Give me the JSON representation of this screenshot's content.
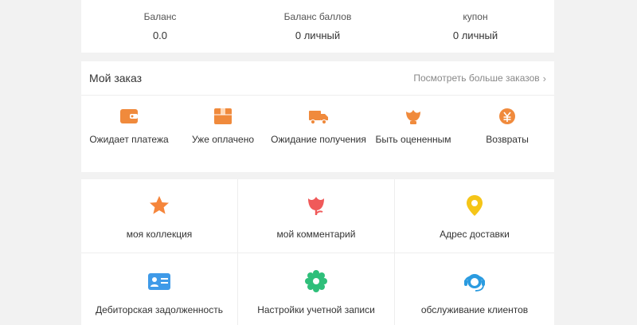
{
  "stats": [
    {
      "label": "Баланс",
      "value": "0.0"
    },
    {
      "label": "Баланс баллов",
      "value": "0 личный"
    },
    {
      "label": "купон",
      "value": "0 личный"
    }
  ],
  "orders": {
    "title": "Мой заказ",
    "more": "Посмотреть больше заказов",
    "items": [
      {
        "label": "Ожидает платежа",
        "icon": "wallet-icon",
        "color": "#f08a3c"
      },
      {
        "label": "Уже оплачено",
        "icon": "box-icon",
        "color": "#f08a3c"
      },
      {
        "label": "Ожидание получения",
        "icon": "truck-icon",
        "color": "#f08a3c"
      },
      {
        "label": "Быть оцененным",
        "icon": "lotus-icon",
        "color": "#f08a3c"
      },
      {
        "label": "Возвраты",
        "icon": "refund-icon",
        "color": "#f08a3c"
      }
    ]
  },
  "grid": [
    {
      "label": "моя коллекция",
      "icon": "star-icon",
      "color": "#f5853b"
    },
    {
      "label": "мой комментарий",
      "icon": "tulip-icon",
      "color": "#f05a5a"
    },
    {
      "label": "Адрес доставки",
      "icon": "location-pin-icon",
      "color": "#f5c518"
    },
    {
      "label": "Дебиторская задолженность",
      "icon": "id-card-icon",
      "color": "#3f9ae8"
    },
    {
      "label": "Настройки учетной записи",
      "icon": "settings-gear-icon",
      "color": "#2fbf7a"
    },
    {
      "label": "обслуживание клиентов",
      "icon": "headset-icon",
      "color": "#2a9be0"
    }
  ]
}
